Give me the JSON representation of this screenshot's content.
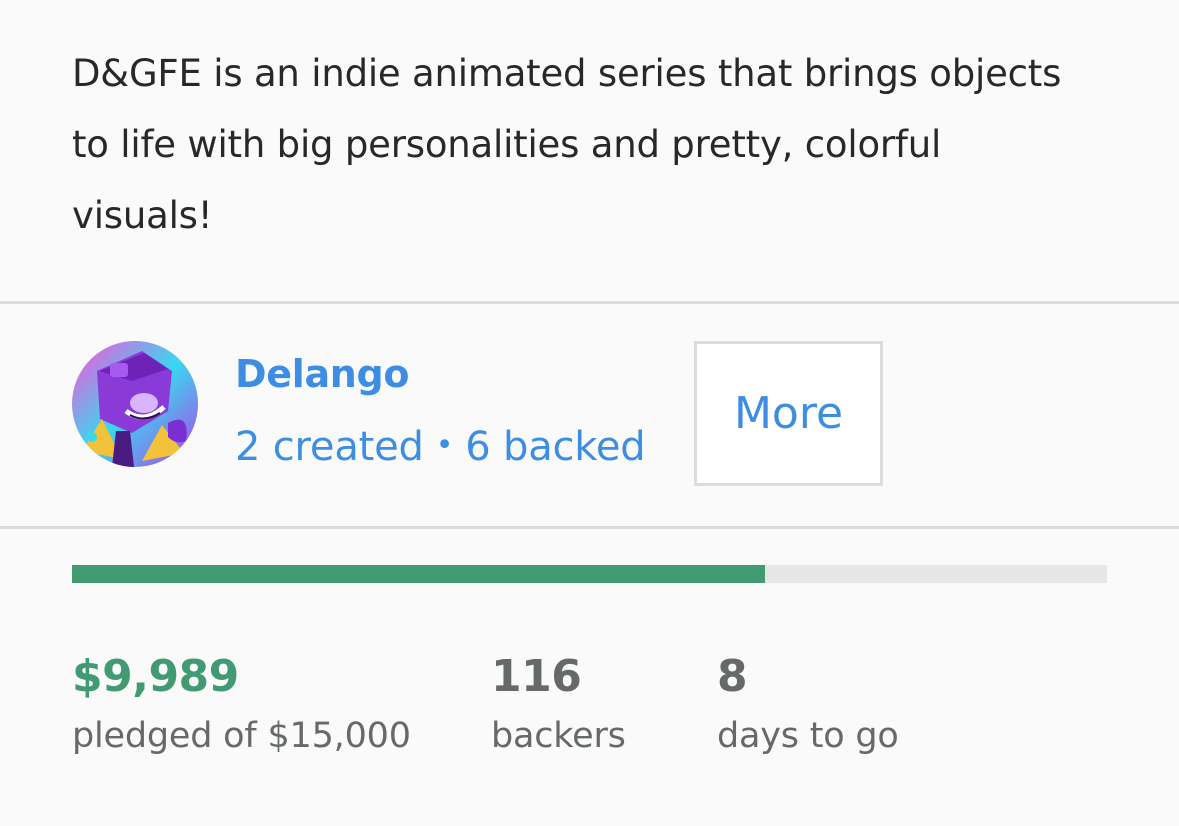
{
  "project": {
    "blurb": "D&GFE is an indie animated series that brings objects to life with big personalities and pretty, colorful visuals!"
  },
  "creator": {
    "name": "Delango",
    "created_text": "2 created",
    "separator": "•",
    "backed_text": "6 backed",
    "more_label": "More",
    "avatar_icon": "avatar-illustration"
  },
  "funding": {
    "progress_fraction": 0.67,
    "pledged_amount": "$9,989",
    "pledged_label": "pledged of $15,000",
    "backers_count": "116",
    "backers_label": "backers",
    "days_count": "8",
    "days_label": "days to go"
  },
  "colors": {
    "link_blue": "#3d8ee3",
    "success_green": "#429a72",
    "muted_text": "#656969",
    "track_gray": "#e6e6e6"
  }
}
